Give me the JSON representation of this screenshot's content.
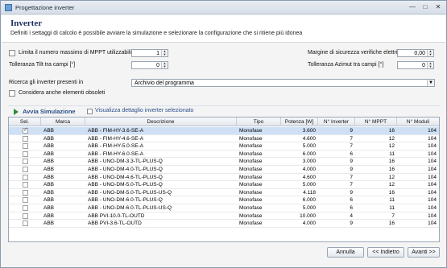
{
  "window": {
    "title": "Progettazione inverter",
    "controls": [
      "—",
      "□",
      "✕"
    ]
  },
  "header": {
    "title": "Inverter",
    "subtitle": "Definiti i settaggi di calcolo è possibile avviare la simulazione e selezionare la configurazione che si ritiene più idonea"
  },
  "settings": {
    "limit_mppt_label": "Limita il numero massimo di MPPT utilizzabili a:",
    "limit_mppt_checked": false,
    "limit_mppt_value": "1",
    "tilt_label": "Tolleranza Tilt tra campi [°]",
    "tilt_value": "0",
    "safety_margin_label": "Margine di sicurezza verifiche elettriche [%]",
    "safety_margin_value": "0,00",
    "azimut_label": "Tolleranza Azimut tra campi [°]",
    "azimut_value": "0",
    "search_label": "Ricerca gli inverter presenti in",
    "search_value": "Archivio del programma",
    "obsolete_label": "Considera anche elementi obsoleti",
    "obsolete_checked": false
  },
  "toolbar": {
    "simulate_label": "Avvia Simulazione",
    "detail_label": "Visualizza dettaglio inverter selezionato"
  },
  "grid": {
    "columns": [
      "Sel.",
      "Marca",
      "Descrizione",
      "Tipo",
      "Potenza [W]",
      "N° Inverter",
      "N° MPPT",
      "N° Moduli"
    ],
    "rows": [
      {
        "sel": true,
        "marca": "ABB",
        "descrizione": "ABB - FIM-HY-3.6-SE-A",
        "tipo": "Monofase",
        "potenza": "3.600",
        "n_inverter": "9",
        "n_mppt": "16",
        "n_moduli": "104"
      },
      {
        "sel": false,
        "marca": "ABB",
        "descrizione": "ABB - FIM-HY-4.6-SE-A",
        "tipo": "Monofase",
        "potenza": "4.600",
        "n_inverter": "7",
        "n_mppt": "12",
        "n_moduli": "104"
      },
      {
        "sel": false,
        "marca": "ABB",
        "descrizione": "ABB - FIM-HY-5.0-SE-A",
        "tipo": "Monofase",
        "potenza": "5.000",
        "n_inverter": "7",
        "n_mppt": "12",
        "n_moduli": "104"
      },
      {
        "sel": false,
        "marca": "ABB",
        "descrizione": "ABB - FIM-HY-6.0-SE-A",
        "tipo": "Monofase",
        "potenza": "6.000",
        "n_inverter": "6",
        "n_mppt": "11",
        "n_moduli": "104"
      },
      {
        "sel": false,
        "marca": "ABB",
        "descrizione": "ABB - UNO-DM-3.3-TL-PLUS-Q",
        "tipo": "Monofase",
        "potenza": "3.000",
        "n_inverter": "9",
        "n_mppt": "16",
        "n_moduli": "104"
      },
      {
        "sel": false,
        "marca": "ABB",
        "descrizione": "ABB - UNO-DM-4.0-TL-PLUS-Q",
        "tipo": "Monofase",
        "potenza": "4.000",
        "n_inverter": "9",
        "n_mppt": "16",
        "n_moduli": "104"
      },
      {
        "sel": false,
        "marca": "ABB",
        "descrizione": "ABB - UNO-DM-4.6-TL-PLUS-Q",
        "tipo": "Monofase",
        "potenza": "4.600",
        "n_inverter": "7",
        "n_mppt": "12",
        "n_moduli": "104"
      },
      {
        "sel": false,
        "marca": "ABB",
        "descrizione": "ABB - UNO-DM-5.0-TL-PLUS-Q",
        "tipo": "Monofase",
        "potenza": "5.000",
        "n_inverter": "7",
        "n_mppt": "12",
        "n_moduli": "104"
      },
      {
        "sel": false,
        "marca": "ABB",
        "descrizione": "ABB - UNO-DM-5.0-TL-PLUS-US-Q",
        "tipo": "Monofase",
        "potenza": "4.118",
        "n_inverter": "9",
        "n_mppt": "16",
        "n_moduli": "104"
      },
      {
        "sel": false,
        "marca": "ABB",
        "descrizione": "ABB - UNO-DM-6.0-TL-PLUS-Q",
        "tipo": "Monofase",
        "potenza": "6.000",
        "n_inverter": "6",
        "n_mppt": "11",
        "n_moduli": "104"
      },
      {
        "sel": false,
        "marca": "ABB",
        "descrizione": "ABB - UNO-DM-6.0-TL-PLUS-US-Q",
        "tipo": "Monofase",
        "potenza": "5.000",
        "n_inverter": "6",
        "n_mppt": "11",
        "n_moduli": "104"
      },
      {
        "sel": false,
        "marca": "ABB",
        "descrizione": "ABB PVI-10.0-TL-OUTD",
        "tipo": "Monofase",
        "potenza": "10.000",
        "n_inverter": "4",
        "n_mppt": "7",
        "n_moduli": "104"
      },
      {
        "sel": false,
        "marca": "ABB",
        "descrizione": "ABB PVI-3.6-TL-OUTD",
        "tipo": "Monofase",
        "potenza": "4.000",
        "n_inverter": "9",
        "n_mppt": "16",
        "n_moduli": "104"
      }
    ]
  },
  "footer": {
    "cancel_label": "Annulla",
    "back_label": "<< Indietro",
    "next_label": "Avanti >>"
  },
  "colors": {
    "header_title": "#1a2f5a",
    "accent": "#2a4d8a",
    "selected_row": "#cfe0f5",
    "play": "#2e8b3a"
  }
}
